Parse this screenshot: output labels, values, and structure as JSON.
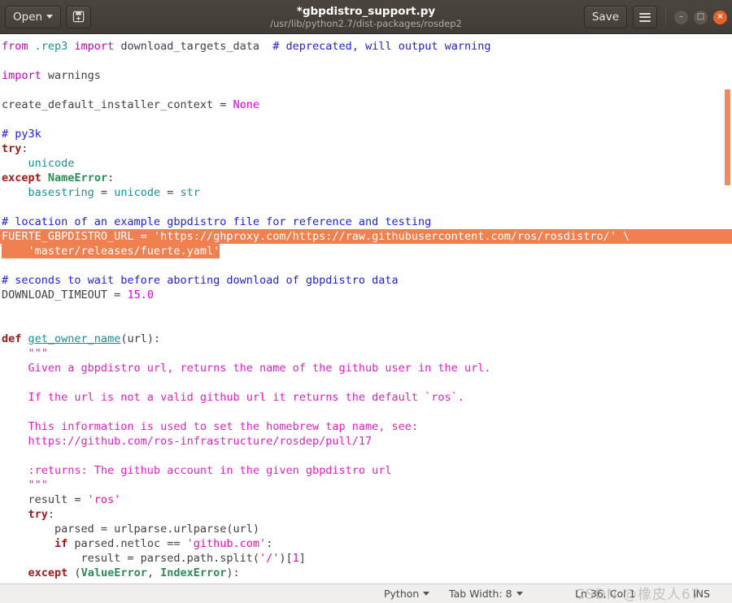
{
  "window": {
    "title": "*gbpdistro_support.py",
    "subtitle": "/usr/lib/python2.7/dist-packages/rosdep2",
    "open_label": "Open",
    "save_label": "Save",
    "icons": {
      "open_caret": "chevron-down-icon",
      "save_as": "save-as-icon",
      "menu": "hamburger-menu-icon",
      "minimize": "–",
      "maximize": "□",
      "close": "×"
    }
  },
  "editor": {
    "lines": [
      {
        "id": "l1",
        "tokens": [
          {
            "t": "from ",
            "c": "imp"
          },
          {
            "t": ".rep3",
            "c": "mod"
          },
          {
            "t": " ",
            "c": "plain"
          },
          {
            "t": "import",
            "c": "imp"
          },
          {
            "t": " download_targets_data  ",
            "c": "plain"
          },
          {
            "t": "# deprecated, will output warning",
            "c": "cmt"
          }
        ]
      },
      {
        "id": "l2",
        "tokens": []
      },
      {
        "id": "l3",
        "tokens": [
          {
            "t": "import",
            "c": "imp"
          },
          {
            "t": " warnings",
            "c": "plain"
          }
        ]
      },
      {
        "id": "l4",
        "tokens": []
      },
      {
        "id": "l5",
        "tokens": [
          {
            "t": "create_default_installer_context = ",
            "c": "plain"
          },
          {
            "t": "None",
            "c": "none"
          }
        ]
      },
      {
        "id": "l6",
        "tokens": []
      },
      {
        "id": "l7",
        "tokens": [
          {
            "t": "# py3k",
            "c": "cmt"
          }
        ]
      },
      {
        "id": "l8",
        "tokens": [
          {
            "t": "try",
            "c": "kw"
          },
          {
            "t": ":",
            "c": "plain"
          }
        ]
      },
      {
        "id": "l9",
        "tokens": [
          {
            "t": "    ",
            "c": "plain"
          },
          {
            "t": "unicode",
            "c": "mod"
          }
        ]
      },
      {
        "id": "l10",
        "tokens": [
          {
            "t": "except",
            "c": "kw"
          },
          {
            "t": " ",
            "c": "plain"
          },
          {
            "t": "NameError",
            "c": "exc"
          },
          {
            "t": ":",
            "c": "plain"
          }
        ]
      },
      {
        "id": "l11",
        "tokens": [
          {
            "t": "    ",
            "c": "plain"
          },
          {
            "t": "basestring",
            "c": "mod"
          },
          {
            "t": " = ",
            "c": "plain"
          },
          {
            "t": "unicode",
            "c": "mod"
          },
          {
            "t": " = ",
            "c": "plain"
          },
          {
            "t": "str",
            "c": "mod"
          }
        ]
      },
      {
        "id": "l12",
        "tokens": []
      },
      {
        "id": "l13",
        "tokens": [
          {
            "t": "# location of an example gbpdistro file for reference and testing",
            "c": "cmt"
          }
        ]
      },
      {
        "id": "l14",
        "selected": true,
        "text": "FUERTE_GBPDISTRO_URL = 'https://ghproxy.com/https://raw.githubusercontent.com/ros/rosdistro/' \\"
      },
      {
        "id": "l15",
        "selected_partial": true,
        "text": "    'master/releases/fuerte.yaml'"
      },
      {
        "id": "l16",
        "tokens": []
      },
      {
        "id": "l17",
        "tokens": [
          {
            "t": "# seconds to wait before aborting download of gbpdistro data",
            "c": "cmt"
          }
        ]
      },
      {
        "id": "l18",
        "tokens": [
          {
            "t": "DOWNLOAD_TIMEOUT = ",
            "c": "plain"
          },
          {
            "t": "15.0",
            "c": "num"
          }
        ]
      },
      {
        "id": "l19",
        "tokens": []
      },
      {
        "id": "l20",
        "tokens": []
      },
      {
        "id": "l21",
        "tokens": [
          {
            "t": "def",
            "c": "kw"
          },
          {
            "t": " ",
            "c": "plain"
          },
          {
            "t": "get_owner_name",
            "c": "fn"
          },
          {
            "t": "(url):",
            "c": "plain"
          }
        ]
      },
      {
        "id": "l22",
        "tokens": [
          {
            "t": "    \"\"\"",
            "c": "doc"
          }
        ]
      },
      {
        "id": "l23",
        "tokens": [
          {
            "t": "    Given a gbpdistro url, returns the name of the github user in the url.",
            "c": "doc"
          }
        ]
      },
      {
        "id": "l24",
        "tokens": []
      },
      {
        "id": "l25",
        "tokens": [
          {
            "t": "    If the url is not a valid github url it returns the default `ros`.",
            "c": "doc"
          }
        ]
      },
      {
        "id": "l26",
        "tokens": []
      },
      {
        "id": "l27",
        "tokens": [
          {
            "t": "    This information is used to set the homebrew tap name, see:",
            "c": "doc"
          }
        ]
      },
      {
        "id": "l28",
        "tokens": [
          {
            "t": "    https://github.com/ros-infrastructure/rosdep/pull/17",
            "c": "doc"
          }
        ]
      },
      {
        "id": "l29",
        "tokens": []
      },
      {
        "id": "l30",
        "tokens": [
          {
            "t": "    :returns: The github account in the given gbpdistro url",
            "c": "doc"
          }
        ]
      },
      {
        "id": "l31",
        "tokens": [
          {
            "t": "    \"\"\"",
            "c": "doc"
          }
        ]
      },
      {
        "id": "l32",
        "tokens": [
          {
            "t": "    result = ",
            "c": "plain"
          },
          {
            "t": "'ros'",
            "c": "str"
          }
        ]
      },
      {
        "id": "l33",
        "tokens": [
          {
            "t": "    ",
            "c": "plain"
          },
          {
            "t": "try",
            "c": "kw"
          },
          {
            "t": ":",
            "c": "plain"
          }
        ]
      },
      {
        "id": "l34",
        "tokens": [
          {
            "t": "        parsed = urlparse.urlparse(url)",
            "c": "plain"
          }
        ]
      },
      {
        "id": "l35",
        "tokens": [
          {
            "t": "        ",
            "c": "plain"
          },
          {
            "t": "if",
            "c": "kw"
          },
          {
            "t": " parsed.netloc == ",
            "c": "plain"
          },
          {
            "t": "'github.com'",
            "c": "str"
          },
          {
            "t": ":",
            "c": "plain"
          }
        ]
      },
      {
        "id": "l36",
        "tokens": [
          {
            "t": "            result = parsed.path.split(",
            "c": "plain"
          },
          {
            "t": "'/'",
            "c": "str"
          },
          {
            "t": ")[",
            "c": "plain"
          },
          {
            "t": "1",
            "c": "num"
          },
          {
            "t": "]",
            "c": "plain"
          }
        ]
      },
      {
        "id": "l37",
        "tokens": [
          {
            "t": "    ",
            "c": "plain"
          },
          {
            "t": "except",
            "c": "kw"
          },
          {
            "t": " (",
            "c": "plain"
          },
          {
            "t": "ValueError",
            "c": "exc"
          },
          {
            "t": ", ",
            "c": "plain"
          },
          {
            "t": "IndexError",
            "c": "exc"
          },
          {
            "t": "):",
            "c": "plain"
          }
        ]
      }
    ]
  },
  "statusbar": {
    "language": "Python",
    "tab_width": "Tab Width: 8",
    "cursor_position": "Ln 36, Col 1",
    "insert_mode": "INS",
    "watermark": "CSDN @橡皮人67"
  },
  "colors": {
    "titlebar_bg": "#413c37",
    "close_button": "#e8622c",
    "selection": "#f08050",
    "scrollbar_thumb": "#f08a5c",
    "comment": "#2020e0",
    "keyword": "#a1181b",
    "string": "#e010a0",
    "docstring": "#e020c0",
    "builtin": "#1a8f8f",
    "exception": "#2e8b57",
    "statusbar_bg": "#f0efee"
  }
}
